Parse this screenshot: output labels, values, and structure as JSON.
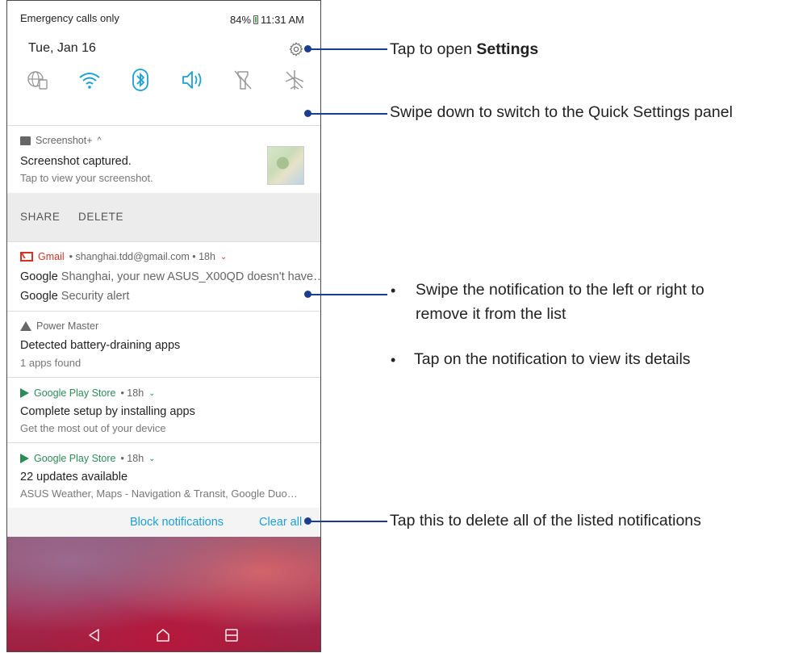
{
  "status_bar": {
    "left": "Emergency calls only",
    "battery": "84%",
    "time": "11:31 AM"
  },
  "date": "Tue, Jan 16",
  "quick_settings": [
    "globe-sim-icon",
    "wifi-icon",
    "bluetooth-icon",
    "volume-icon",
    "flashlight-icon",
    "airplane-icon"
  ],
  "notifications": {
    "screenshot": {
      "app": "Screenshot+",
      "title": "Screenshot captured.",
      "text": "Tap to view your screenshot.",
      "actions": [
        "SHARE",
        "DELETE"
      ]
    },
    "gmail": {
      "app": "Gmail",
      "meta": "• shanghai.tdd@gmail.com • 18h",
      "line1_sender": "Google",
      "line1_text": "Shanghai, your new ASUS_X00QD doesn't have…",
      "line2_sender": "Google",
      "line2_text": "Security alert"
    },
    "power_master": {
      "app": "Power Master",
      "title": "Detected battery-draining apps",
      "text": "1 apps found"
    },
    "play_store_1": {
      "app": "Google Play Store",
      "meta": "• 18h",
      "title": "Complete setup by installing apps",
      "text": "Get the most out of your device"
    },
    "play_store_2": {
      "app": "Google Play Store",
      "meta": "• 18h",
      "title": "22 updates available",
      "text": "ASUS Weather, Maps - Navigation & Transit, Google Duo…"
    }
  },
  "bottom_actions": {
    "block": "Block notifications",
    "clear": "Clear all"
  },
  "annotations": {
    "settings_prefix": "Tap to open ",
    "settings_bold": "Settings",
    "quick_settings": "Swipe down to switch to the Quick Settings panel",
    "swipe_line1": "Swipe the notification to the left or right to",
    "swipe_line2": "remove it from the list",
    "tap_details": "Tap on the notification to view its details",
    "clear_all": "Tap this to delete all of the listed notifications"
  },
  "colors": {
    "accent_blue": "#1aa0d6",
    "annotation_line": "#1b3d8f",
    "gmail_red": "#d93025",
    "play_green": "#2e8b57"
  }
}
